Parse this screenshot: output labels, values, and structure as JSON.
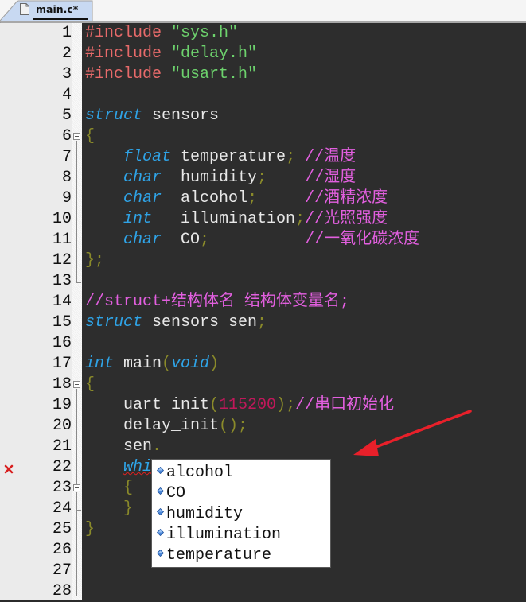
{
  "tab": {
    "label": "main.c*",
    "icon": "file-icon"
  },
  "editor": {
    "line_numbers": [
      "1",
      "2",
      "3",
      "4",
      "5",
      "6",
      "7",
      "8",
      "9",
      "10",
      "11",
      "12",
      "13",
      "14",
      "15",
      "16",
      "17",
      "18",
      "19",
      "20",
      "21",
      "22",
      "23",
      "24",
      "25",
      "26",
      "27",
      "28"
    ],
    "lines": [
      {
        "n": 1,
        "tokens": [
          {
            "t": "#include",
            "c": "pp"
          },
          {
            "t": " "
          },
          {
            "t": "\"sys.h\"",
            "c": "str"
          }
        ]
      },
      {
        "n": 2,
        "tokens": [
          {
            "t": "#include",
            "c": "pp"
          },
          {
            "t": " "
          },
          {
            "t": "\"delay.h\"",
            "c": "str"
          }
        ]
      },
      {
        "n": 3,
        "tokens": [
          {
            "t": "#include",
            "c": "pp"
          },
          {
            "t": " "
          },
          {
            "t": "\"usart.h\"",
            "c": "str"
          }
        ]
      },
      {
        "n": 4,
        "tokens": []
      },
      {
        "n": 5,
        "tokens": [
          {
            "t": "struct",
            "c": "kw"
          },
          {
            "t": " sensors"
          }
        ]
      },
      {
        "n": 6,
        "tokens": [
          {
            "t": "{",
            "c": "pn"
          }
        ]
      },
      {
        "n": 7,
        "tokens": [
          {
            "t": "    "
          },
          {
            "t": "float",
            "c": "kw"
          },
          {
            "t": " temperature"
          },
          {
            "t": ";",
            "c": "pn"
          },
          {
            "t": " "
          },
          {
            "t": "//温度",
            "c": "cm"
          }
        ]
      },
      {
        "n": 8,
        "tokens": [
          {
            "t": "    "
          },
          {
            "t": "char",
            "c": "kw"
          },
          {
            "t": "  humidity"
          },
          {
            "t": ";",
            "c": "pn"
          },
          {
            "t": "    "
          },
          {
            "t": "//湿度",
            "c": "cm"
          }
        ]
      },
      {
        "n": 9,
        "tokens": [
          {
            "t": "    "
          },
          {
            "t": "char",
            "c": "kw"
          },
          {
            "t": "  alcohol"
          },
          {
            "t": ";",
            "c": "pn"
          },
          {
            "t": "     "
          },
          {
            "t": "//酒精浓度",
            "c": "cm"
          }
        ]
      },
      {
        "n": 10,
        "tokens": [
          {
            "t": "    "
          },
          {
            "t": "int",
            "c": "kw"
          },
          {
            "t": "   illumination"
          },
          {
            "t": ";",
            "c": "pn"
          },
          {
            "t": "//光照强度",
            "c": "cm"
          }
        ]
      },
      {
        "n": 11,
        "tokens": [
          {
            "t": "    "
          },
          {
            "t": "char",
            "c": "kw"
          },
          {
            "t": "  CO"
          },
          {
            "t": ";",
            "c": "pn"
          },
          {
            "t": "          "
          },
          {
            "t": "//一氧化碳浓度",
            "c": "cm"
          }
        ]
      },
      {
        "n": 12,
        "tokens": [
          {
            "t": "};",
            "c": "pn"
          }
        ]
      },
      {
        "n": 13,
        "tokens": []
      },
      {
        "n": 14,
        "tokens": [
          {
            "t": "//struct+结构体名 结构体变量名;",
            "c": "cm"
          }
        ]
      },
      {
        "n": 15,
        "tokens": [
          {
            "t": "struct",
            "c": "kw"
          },
          {
            "t": " sensors sen"
          },
          {
            "t": ";",
            "c": "pn"
          }
        ]
      },
      {
        "n": 16,
        "tokens": []
      },
      {
        "n": 17,
        "tokens": [
          {
            "t": "int",
            "c": "kw"
          },
          {
            "t": " main"
          },
          {
            "t": "(",
            "c": "pn"
          },
          {
            "t": "void",
            "c": "kw"
          },
          {
            "t": ")",
            "c": "pn"
          }
        ]
      },
      {
        "n": 18,
        "tokens": [
          {
            "t": "{",
            "c": "pn"
          }
        ]
      },
      {
        "n": 19,
        "tokens": [
          {
            "t": "    uart_init"
          },
          {
            "t": "(",
            "c": "pn"
          },
          {
            "t": "115200",
            "c": "num"
          },
          {
            "t": ");",
            "c": "pn"
          },
          {
            "t": "//串口初始化",
            "c": "cm"
          }
        ]
      },
      {
        "n": 20,
        "tokens": [
          {
            "t": "    delay_init"
          },
          {
            "t": "();",
            "c": "pn"
          }
        ]
      },
      {
        "n": 21,
        "tokens": [
          {
            "t": "    sen"
          },
          {
            "t": ".",
            "c": "pn"
          }
        ]
      },
      {
        "n": 22,
        "tokens": [
          {
            "t": "    "
          },
          {
            "t": "while",
            "c": "kw err"
          }
        ]
      },
      {
        "n": 23,
        "tokens": [
          {
            "t": "    "
          },
          {
            "t": "{",
            "c": "pn"
          }
        ]
      },
      {
        "n": 24,
        "tokens": [
          {
            "t": "    "
          },
          {
            "t": "}",
            "c": "pn"
          }
        ]
      },
      {
        "n": 25,
        "tokens": [
          {
            "t": "}",
            "c": "pn"
          }
        ]
      },
      {
        "n": 26,
        "tokens": []
      },
      {
        "n": 27,
        "tokens": []
      },
      {
        "n": 28,
        "tokens": []
      }
    ],
    "error_marker_line": "22"
  },
  "autocomplete": {
    "items": [
      "alcohol",
      "CO",
      "humidity",
      "illumination",
      "temperature"
    ],
    "item_icon": "member-diamond-icon"
  },
  "colors": {
    "keyword": "#2fa3e6",
    "preprocessor": "#e76a6a",
    "string": "#6dd26d",
    "comment": "#e25fdf",
    "punctuation": "#8a8a2a",
    "number": "#c0185a",
    "arrow": "#e8202a"
  }
}
